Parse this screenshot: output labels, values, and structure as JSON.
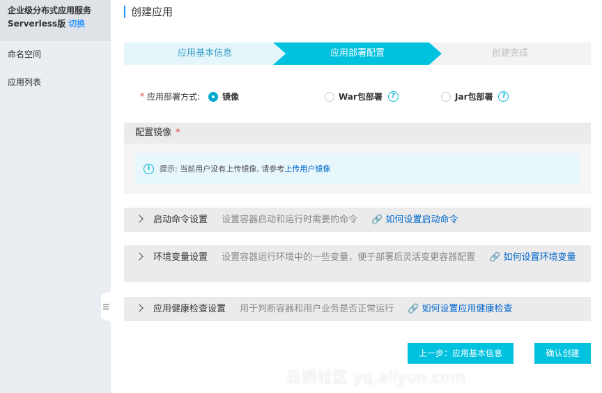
{
  "sidebar": {
    "title": "企业级分布式应用服务",
    "subtitle": "Serverless版",
    "switch_label": "切换",
    "items": [
      {
        "label": "命名空间"
      },
      {
        "label": "应用列表"
      }
    ],
    "collapse_glyph": "☰"
  },
  "page": {
    "title": "创建应用"
  },
  "steps": [
    {
      "label": "应用基本信息",
      "state": "done"
    },
    {
      "label": "应用部署配置",
      "state": "active"
    },
    {
      "label": "创建完成",
      "state": "pending"
    }
  ],
  "deploy": {
    "required_mark": "*",
    "label": "应用部署方式:",
    "options": [
      {
        "label": "镜像",
        "checked": true
      },
      {
        "label": "War包部署",
        "checked": false,
        "help": "?"
      },
      {
        "label": "Jar包部署",
        "checked": false,
        "help": "?"
      }
    ]
  },
  "config_image": {
    "title": "配置镜像",
    "required_mark": "*",
    "info_glyph": "i",
    "tip_text": "提示: 当前用户没有上传镜像, 请参考",
    "tip_link": "上传用户镜像"
  },
  "sections": [
    {
      "title": "启动命令设置",
      "desc": "设置容器启动和运行时需要的命令",
      "link": "如何设置启动命令"
    },
    {
      "title": "环境变量设置",
      "desc": "设置容器运行环境中的一些变量，便于部署后灵活变更容器配置",
      "link": "如何设置环境变量"
    },
    {
      "title": "应用健康检查设置",
      "desc": "用于判断容器和用户业务是否正常运行",
      "link": "如何设置应用健康检查"
    }
  ],
  "buttons": {
    "prev": "上一步：应用基本信息",
    "confirm": "确认创建"
  },
  "watermark": "云栖社区 yq.aliyun.com",
  "colors": {
    "accent": "#00c1de",
    "link": "#0066cc",
    "required": "#e4393c"
  }
}
